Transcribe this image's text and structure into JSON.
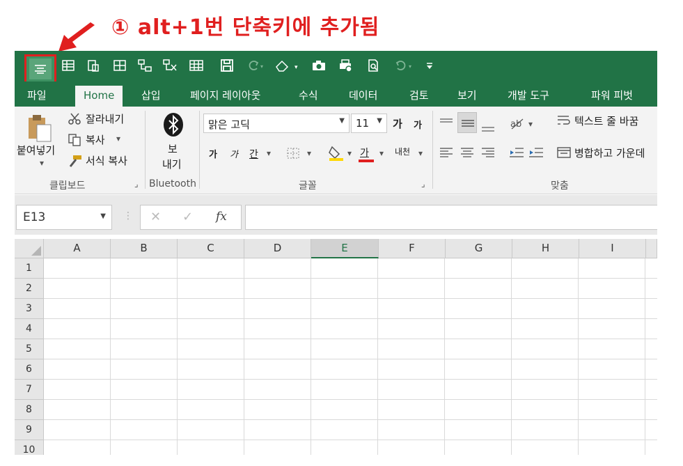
{
  "annotation": {
    "text": "① alt+1번 단축키에 추가됨",
    "color": "#e01f1f"
  },
  "colors": {
    "excel_green": "#217346",
    "highlight": "#e01f1f"
  },
  "qat": {
    "icons": [
      "align-center-icon",
      "form-icon",
      "paste-special-icon",
      "borders-icon",
      "shapes-icon",
      "freeze-icon",
      "table-icon",
      "save-icon",
      "redo-icon",
      "eraser-icon",
      "camera-icon",
      "print-preview-icon",
      "find-icon",
      "undo-icon",
      "customize-icon"
    ]
  },
  "tabs": [
    "파일",
    "Home",
    "삽입",
    "페이지 레이아웃",
    "수식",
    "데이터",
    "검토",
    "보기",
    "개발 도구",
    "파워 피벗"
  ],
  "active_tab": "Home",
  "ribbon": {
    "clipboard": {
      "paste": "붙여넣기",
      "cut": "잘라내기",
      "copy": "복사",
      "format_painter": "서식 복사",
      "label": "클립보드"
    },
    "bluetooth": {
      "send_line1": "보",
      "send_line2": "내기",
      "label": "Bluetooth"
    },
    "font": {
      "name": "맑은 고딕",
      "size": "11",
      "grow": "가",
      "shrink": "가",
      "bold": "가",
      "italic": "가",
      "underline": "간",
      "fill_char": "가",
      "phonetic": "내천",
      "label": "글꼴"
    },
    "alignment": {
      "wrap_text": "텍스트 줄 바꿈",
      "merge_center": "병합하고 가운데",
      "label": "맞춤"
    }
  },
  "formula_bar": {
    "name_box": "E13",
    "cancel": "✕",
    "enter": "✓",
    "fx": "fx",
    "value": ""
  },
  "sheet": {
    "columns": [
      "A",
      "B",
      "C",
      "D",
      "E",
      "F",
      "G",
      "H",
      "I"
    ],
    "selected_column": "E",
    "rows": [
      "1",
      "2",
      "3",
      "4",
      "5",
      "6",
      "7",
      "8",
      "9",
      "10"
    ]
  }
}
